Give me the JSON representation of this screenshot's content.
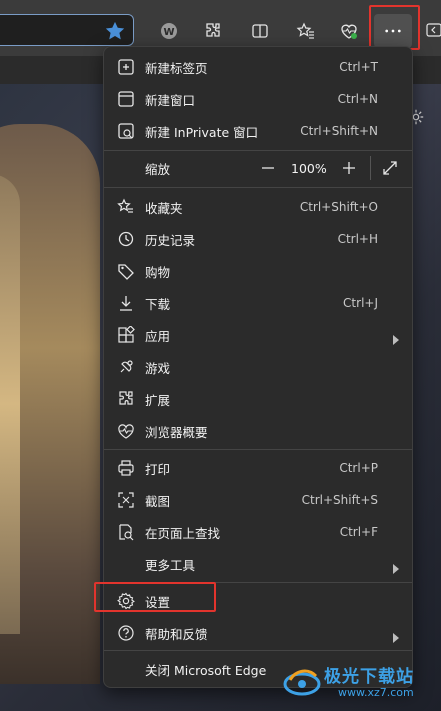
{
  "menu": {
    "items": [
      {
        "label": "新建标签页",
        "shortcut": "Ctrl+T",
        "icon": "new-tab-icon"
      },
      {
        "label": "新建窗口",
        "shortcut": "Ctrl+N",
        "icon": "new-window-icon"
      },
      {
        "label": "新建 InPrivate 窗口",
        "shortcut": "Ctrl+Shift+N",
        "icon": "inprivate-icon"
      },
      {
        "label": "缩放",
        "zoom_value": "100%"
      },
      {
        "label": "收藏夹",
        "shortcut": "Ctrl+Shift+O",
        "icon": "favorites-icon"
      },
      {
        "label": "历史记录",
        "shortcut": "Ctrl+H",
        "icon": "history-icon"
      },
      {
        "label": "购物",
        "shortcut": "",
        "icon": "shopping-tag-icon"
      },
      {
        "label": "下载",
        "shortcut": "Ctrl+J",
        "icon": "download-icon"
      },
      {
        "label": "应用",
        "shortcut": "",
        "icon": "apps-icon"
      },
      {
        "label": "游戏",
        "shortcut": "",
        "icon": "games-icon"
      },
      {
        "label": "扩展",
        "shortcut": "",
        "icon": "extensions-icon"
      },
      {
        "label": "浏览器概要",
        "shortcut": "",
        "icon": "browser-essentials-icon"
      },
      {
        "label": "打印",
        "shortcut": "Ctrl+P",
        "icon": "print-icon"
      },
      {
        "label": "截图",
        "shortcut": "Ctrl+Shift+S",
        "icon": "screenshot-icon"
      },
      {
        "label": "在页面上查找",
        "shortcut": "Ctrl+F",
        "icon": "find-icon"
      },
      {
        "label": "更多工具",
        "shortcut": ""
      },
      {
        "label": "设置",
        "shortcut": "",
        "icon": "gear-icon"
      },
      {
        "label": "帮助和反馈",
        "shortcut": "",
        "icon": "help-icon"
      },
      {
        "label": "关闭 Microsoft Edge",
        "shortcut": ""
      }
    ]
  },
  "toolbar": {
    "profile_letter": "W"
  },
  "watermark": {
    "text": "极光下载站",
    "url": "www.xz7.com"
  },
  "colors": {
    "highlight": "#e2342d",
    "accent": "#3da1e6",
    "menu_bg": "#2b2b2b"
  }
}
